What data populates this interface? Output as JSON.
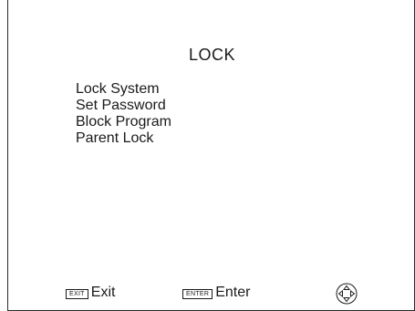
{
  "menu": {
    "title": "LOCK",
    "items": [
      {
        "label": "Lock System"
      },
      {
        "label": "Set Password"
      },
      {
        "label": "Block Program"
      },
      {
        "label": "Parent Lock"
      }
    ]
  },
  "footer": {
    "exit_key": "EXIT",
    "exit_label": "Exit",
    "enter_key": "ENTER",
    "enter_label": "Enter",
    "nav_icon": "dpad-icon"
  }
}
